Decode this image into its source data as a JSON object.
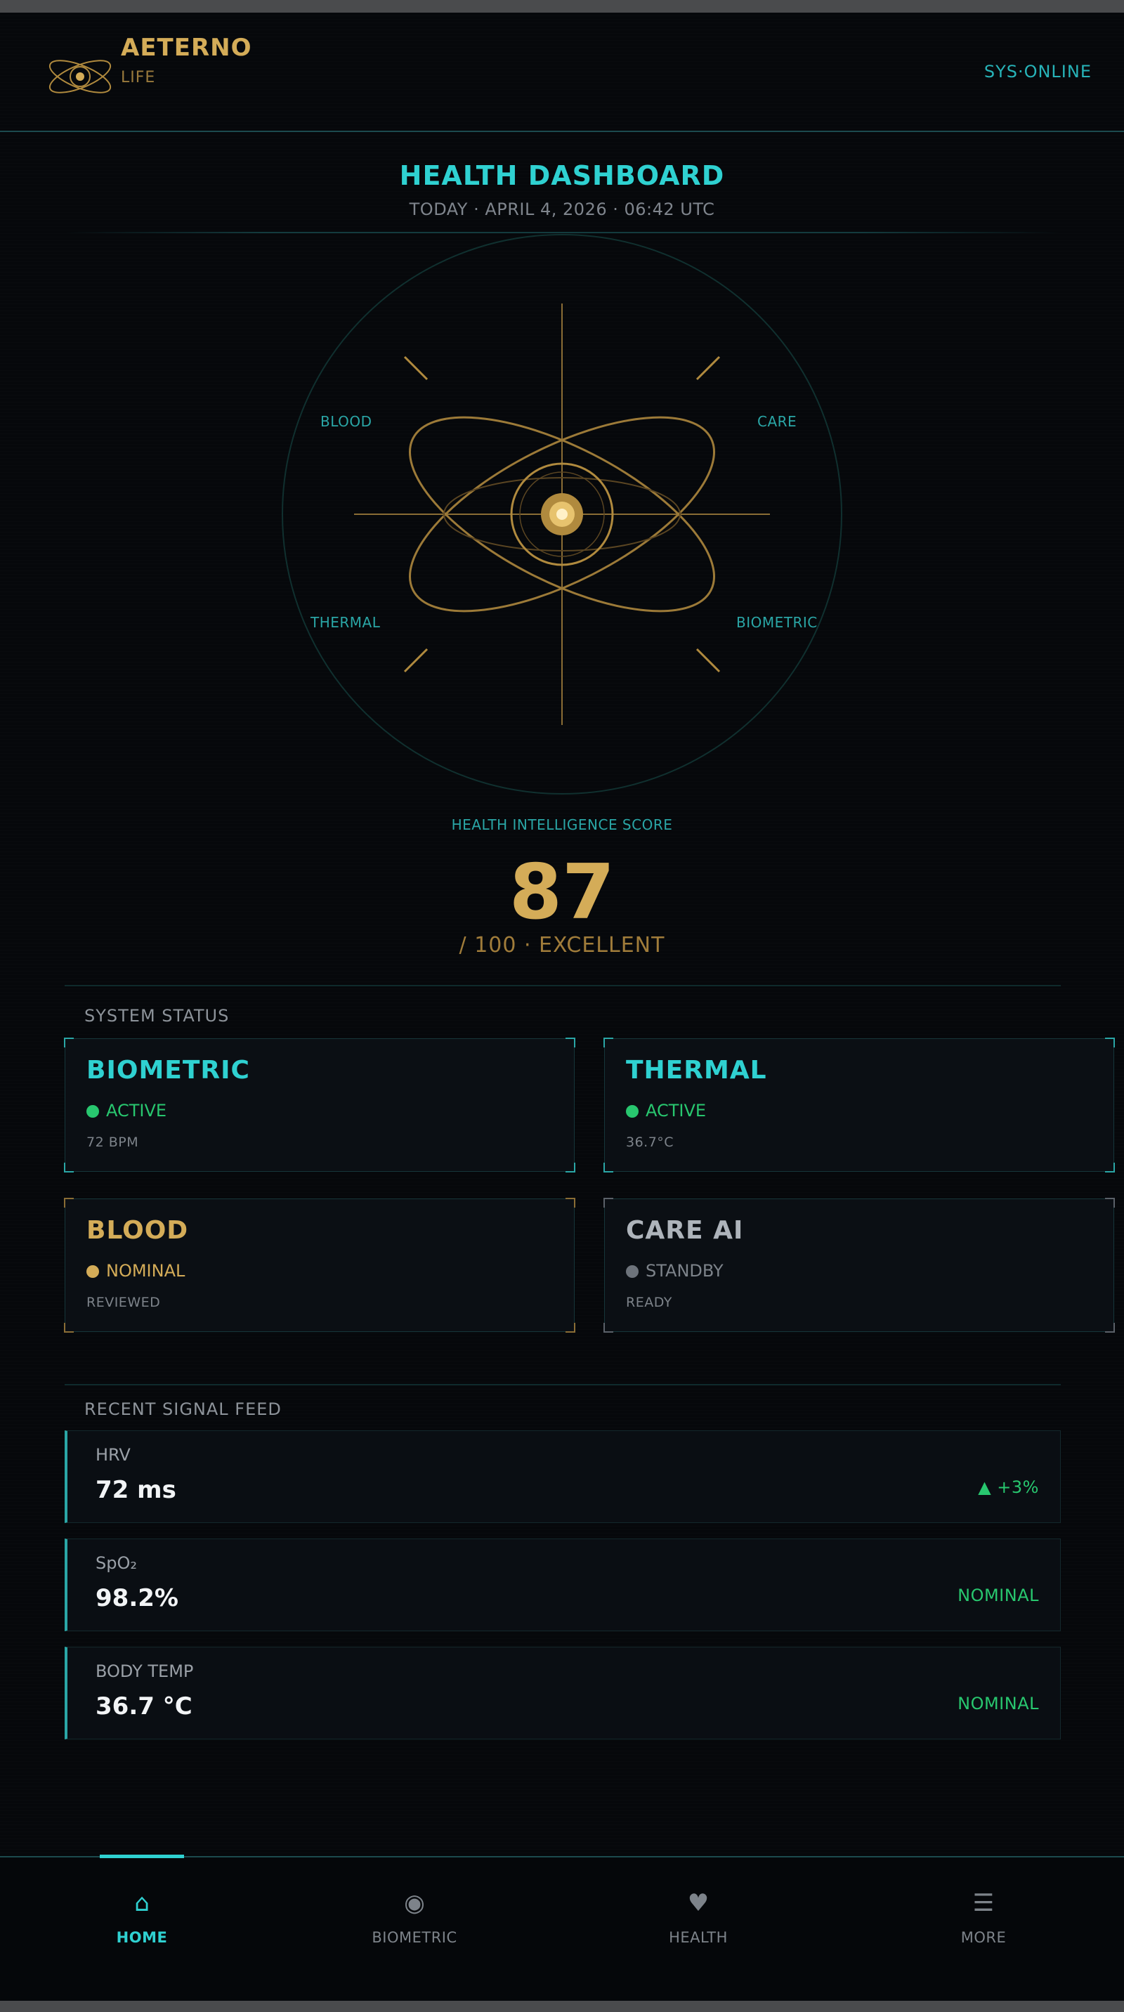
{
  "colors": {
    "accent_teal": "#2fd1d1",
    "accent_gold": "#d4ac58",
    "status_green": "#28c76f",
    "standby_grey": "#8a9099"
  },
  "header": {
    "brand": "AETERNO",
    "brand_sub": "LIFE",
    "status": "SYS·ONLINE",
    "logo_icon": "orbit-logo-icon"
  },
  "title": {
    "heading": "HEALTH DASHBOARD",
    "date": "TODAY · APRIL 4, 2026 · 06:42 UTC"
  },
  "emblem": {
    "labels": {
      "top_left": "BLOOD",
      "top_right": "CARE",
      "bottom_left": "THERMAL",
      "bottom_right": "BIOMETRIC"
    }
  },
  "score": {
    "label": "HEALTH INTELLIGENCE SCORE",
    "value": "87",
    "suffix": "/ 100  ·  EXCELLENT"
  },
  "system_status": {
    "title": "SYSTEM STATUS",
    "cards": [
      {
        "title": "BIOMETRIC",
        "state": "ACTIVE",
        "value": "72 BPM",
        "color": "#2fd1d1",
        "dot": "#28c76f",
        "state_color": "#28c76f"
      },
      {
        "title": "THERMAL",
        "state": "ACTIVE",
        "value": "36.7°C",
        "color": "#2fd1d1",
        "dot": "#28c76f",
        "state_color": "#28c76f"
      },
      {
        "title": "BLOOD",
        "state": "NOMINAL",
        "value": "REVIEWED",
        "color": "#d4ac58",
        "dot": "#d4ac58",
        "state_color": "#d4ac58"
      },
      {
        "title": "CARE AI",
        "state": "STANDBY",
        "value": "READY",
        "color": "#aeb4bb",
        "dot": "#6d737b",
        "state_color": "#7d838a"
      }
    ]
  },
  "feed": {
    "title": "RECENT SIGNAL FEED",
    "items": [
      {
        "label": "HRV",
        "value": "72 ms",
        "status": "▲ +3%"
      },
      {
        "label": "SpO₂",
        "value": "98.2%",
        "status": "NOMINAL"
      },
      {
        "label": "BODY TEMP",
        "value": "36.7 °C",
        "status": "NOMINAL"
      }
    ]
  },
  "nav": {
    "items": [
      {
        "label": "HOME",
        "icon": "⌂",
        "icon_name": "home-icon",
        "active": true
      },
      {
        "label": "BIOMETRIC",
        "icon": "◉",
        "icon_name": "biometric-icon",
        "active": false
      },
      {
        "label": "HEALTH",
        "icon": "♥",
        "icon_name": "heart-icon",
        "active": false
      },
      {
        "label": "MORE",
        "icon": "☰",
        "icon_name": "menu-icon",
        "active": false
      }
    ]
  }
}
